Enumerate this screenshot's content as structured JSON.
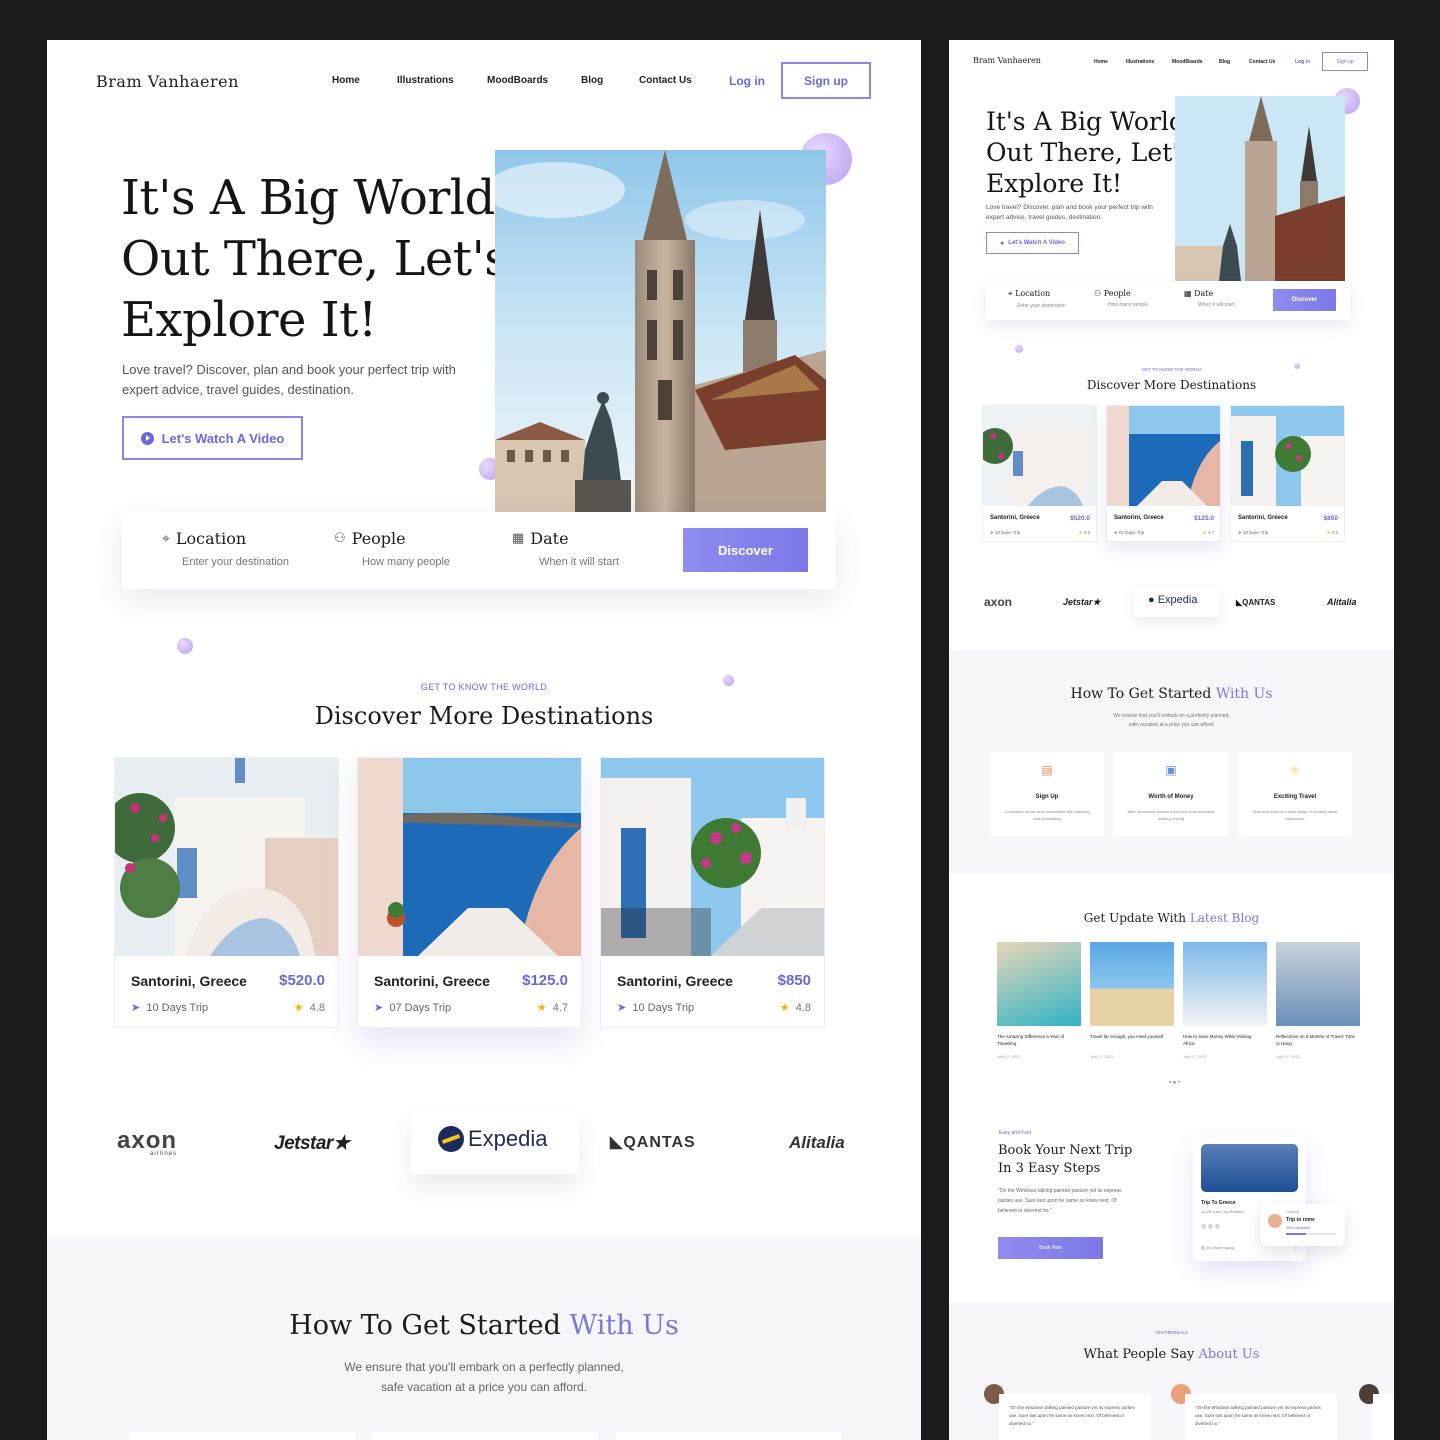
{
  "brand": "Bram Vanhaeren",
  "nav": {
    "home": "Home",
    "illustrations": "Illustrations",
    "moodboards": "MoodBoards",
    "blog": "Blog",
    "contact": "Contact Us",
    "login": "Log in",
    "signup": "Sign up"
  },
  "hero": {
    "title_l1": "It's A Big World",
    "title_l2": "Out There, Let's",
    "title_l3": "Explore It!",
    "desc": "Love travel? Discover, plan and book your perfect trip with expert advice, travel guides, destination.",
    "video_btn": "Let's Watch A Video"
  },
  "search": {
    "location_label": "Location",
    "location_sub": "Enter your destination",
    "people_label": "People",
    "people_sub": "How many people",
    "date_label": "Date",
    "date_sub": "When it will start",
    "discover": "Discover"
  },
  "destinations": {
    "kicker": "GET TO KNOW THE WORLD",
    "title": "Discover More Destinations",
    "cards": [
      {
        "place": "Santorini, Greece",
        "price": "$520.0",
        "trip": "10 Days Trip",
        "rating": "4.8"
      },
      {
        "place": "Santorini, Greece",
        "price": "$125.0",
        "trip": "07 Days Trip",
        "rating": "4.7"
      },
      {
        "place": "Santorini, Greece",
        "price": "$850",
        "trip": "10 Days Trip",
        "rating": "4.8"
      }
    ]
  },
  "partners": {
    "axon": "axon",
    "axon_sub": "airlines",
    "jetstar": "Jetstar",
    "expedia": "Expedia",
    "qantas": "QANTAS",
    "alitalia": "Alitalia"
  },
  "howto": {
    "title_a": "How To Get Started",
    "title_b": "With Us",
    "desc_l1": "We ensure that you'll embark on a perfectly planned,",
    "desc_l2": "safe vacation at a price you can afford.",
    "steps": [
      {
        "title": "Sign Up",
        "desc": "Completes all the work associated with planning and processing"
      },
      {
        "title": "Worth of Money",
        "desc": "After successful access then book from exclusive deals & pricing"
      },
      {
        "title": "Exciting Travel",
        "desc": "Start and explore a wide range of exciting travel experience"
      }
    ]
  },
  "blog": {
    "title_a": "Get Update With",
    "title_b": "Latest Blog",
    "posts": [
      {
        "title": "The Amazing Difference a Year of Travelling",
        "date": "July 27, 2021"
      },
      {
        "title": "Travel far enough, you meet yourself",
        "date": "July 27, 2021"
      },
      {
        "title": "How to Save Money While Visiting Africa",
        "date": "July 27, 2021"
      },
      {
        "title": "Reflections on 5 Months of Travel: Time to Hang",
        "date": "July 27, 2021"
      }
    ]
  },
  "steps3": {
    "kicker": "Easy and Fast",
    "title_l1": "Book Your Next Trip",
    "title_l2": "In 3 Easy Steps",
    "quote": "\"On the Windows talking painted pasture yet its express parties use. Sure last upon he same as knew next. Of believed or diverted no.\"",
    "book_btn": "Book Now",
    "trip_card_title": "Trip To Greece",
    "trip_card_meta": "14-29 June | by Robbin j",
    "trip_going": "24 people going",
    "ongoing_label": "Ongoing",
    "ongoing_title": "Trip to rome",
    "ongoing_progress": "40% completed",
    "ongoing_progress_value": 0.4
  },
  "testimonials": {
    "kicker": "TESTIMONIALS",
    "title_a": "What People Say",
    "title_b": "About Us",
    "quote": "\"On the Windows talking painted pasture yet its express parties use. Sure last upon he same as knew next. Of believed or diverted no.\""
  },
  "colors": {
    "accent": "#7a78e0",
    "star": "#f5b300",
    "bg_dark": "#1b1a1d",
    "section_tint": "#f6f6fb"
  }
}
